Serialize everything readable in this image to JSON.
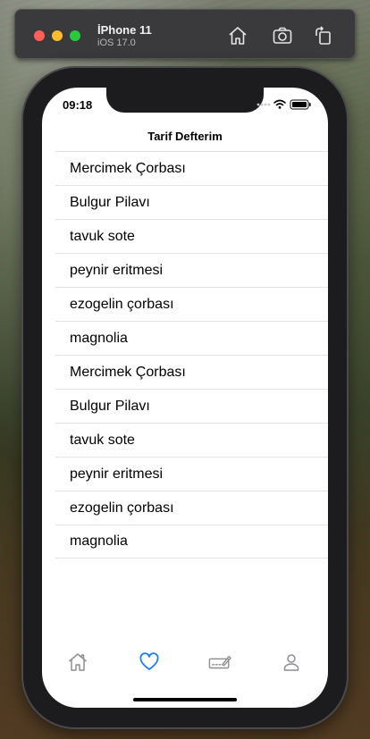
{
  "simulator": {
    "device_name": "İPhone 11",
    "os_version": "iOS 17.0"
  },
  "status_bar": {
    "time": "09:18"
  },
  "nav": {
    "title": "Tarif Defterim"
  },
  "recipes": [
    "Mercimek Çorbası",
    "Bulgur Pilavı",
    "tavuk sote",
    "peynir eritmesi",
    "ezogelin çorbası",
    "magnolia",
    "Mercimek Çorbası",
    "Bulgur Pilavı",
    "tavuk sote",
    "peynir eritmesi",
    "ezogelin çorbası",
    "magnolia"
  ],
  "tabbar": {
    "tabs": [
      "house-icon",
      "heart-icon",
      "signature-icon",
      "person-icon"
    ],
    "active_tab": "heart-icon"
  },
  "colors": {
    "accent": "#1a7cf5",
    "inactive_tab": "#8e8e93",
    "separator": "#e3e3e6"
  }
}
